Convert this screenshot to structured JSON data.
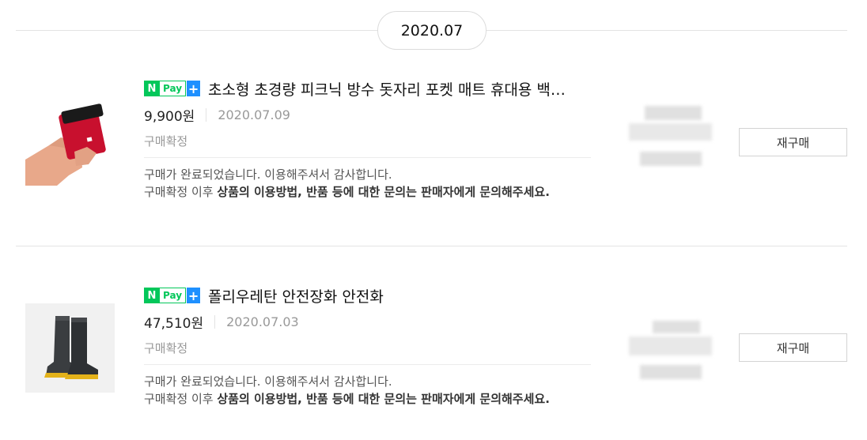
{
  "month_label": "2020.07",
  "badge": {
    "n": "N",
    "pay": "Pay",
    "plus": "+"
  },
  "orders": [
    {
      "product_name": "초소형 초경량 피크닉 방수 돗자리 포켓 매트 휴대용 백…",
      "price": "9,900원",
      "order_date": "2020.07.09",
      "status": "구매확정",
      "message_line1": "구매가 완료되었습니다. 이용해주셔서 감사합니다.",
      "message_line2_prefix": "구매확정 이후 ",
      "message_line2_bold": "상품의 이용방법, 반품 등에 대한 문의는 판매자에게 문의해주세요.",
      "rebuy_label": "재구매"
    },
    {
      "product_name": "폴리우레탄 안전장화 안전화",
      "price": "47,510원",
      "order_date": "2020.07.03",
      "status": "구매확정",
      "message_line1": "구매가 완료되었습니다. 이용해주셔서 감사합니다.",
      "message_line2_prefix": "구매확정 이후 ",
      "message_line2_bold": "상품의 이용방법, 반품 등에 대한 문의는 판매자에게 문의해주세요.",
      "rebuy_label": "재구매"
    }
  ],
  "colors": {
    "npay_green": "#03c75a",
    "npay_blue": "#1e90ff",
    "divider": "#e3e3e3"
  }
}
